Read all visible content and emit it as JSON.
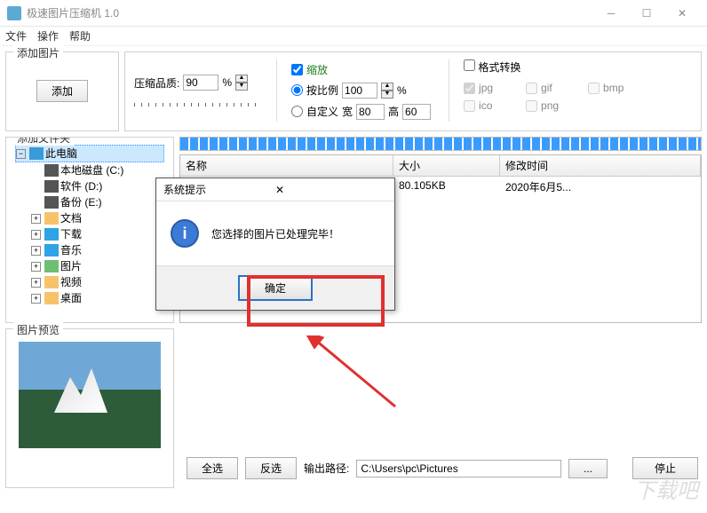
{
  "window": {
    "title": "极速图片压缩机 1.0"
  },
  "menu": {
    "file": "文件",
    "action": "操作",
    "help": "帮助"
  },
  "add_group": {
    "legend": "添加图片",
    "button": "添加"
  },
  "quality": {
    "label": "压缩品质:",
    "value": "90",
    "pct": "%"
  },
  "scale": {
    "legend": "缩放",
    "checked": true,
    "by_ratio": "按比例",
    "ratio_value": "100",
    "pct": "%",
    "custom": "自定义",
    "w_label": "宽",
    "w_value": "80",
    "h_label": "高",
    "h_value": "60"
  },
  "format": {
    "legend": "格式转换",
    "opts": [
      "jpg",
      "gif",
      "bmp",
      "ico",
      "png"
    ]
  },
  "folder_group": {
    "legend": "添加文件夹"
  },
  "tree": {
    "root": "此电脑",
    "items": [
      {
        "label": "本地磁盘 (C:)",
        "icon": "drive"
      },
      {
        "label": "软件 (D:)",
        "icon": "drive"
      },
      {
        "label": "备份 (E:)",
        "icon": "drive"
      },
      {
        "label": "文档",
        "icon": "folder",
        "exp": true
      },
      {
        "label": "下载",
        "icon": "dl",
        "exp": true
      },
      {
        "label": "音乐",
        "icon": "music",
        "exp": true
      },
      {
        "label": "图片",
        "icon": "img",
        "exp": true
      },
      {
        "label": "视频",
        "icon": "folder",
        "exp": true
      },
      {
        "label": "桌面",
        "icon": "folder",
        "exp": true
      }
    ]
  },
  "table": {
    "headers": {
      "name": "名称",
      "size": "大小",
      "date": "修改时间"
    },
    "rows": [
      {
        "name": "",
        "size": "80.105KB",
        "date": "2020年6月5..."
      }
    ]
  },
  "preview": {
    "legend": "图片预览"
  },
  "bottom": {
    "select_all": "全选",
    "invert": "反选",
    "path_label": "输出路径:",
    "path_value": "C:\\Users\\pc\\Pictures",
    "browse": "...",
    "stop": "停止"
  },
  "dialog": {
    "title": "系统提示",
    "message": "您选择的图片已处理完毕！",
    "ok": "确定"
  }
}
